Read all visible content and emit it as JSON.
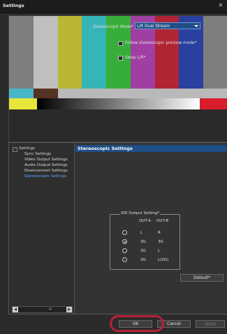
{
  "window": {
    "title": "Settings",
    "close_glyph": "✕"
  },
  "colors": {
    "bars_top": [
      "#7e7e7e",
      "#bfbfbf",
      "#b9b634",
      "#35b5b5",
      "#38ae3a",
      "#a13ea3",
      "#b12434",
      "#2940a0",
      "#7e7e7e"
    ],
    "bars_mid": [
      "#46b6c8",
      "#563222",
      "#b9b9b9",
      "#b9b9b9",
      "#b9b9b9",
      "#b9b9b9",
      "#b9b9b9",
      "#b9b9b9",
      "#b9b9b9"
    ],
    "bars_low_left": "#e6e63a",
    "bars_low_right": "#d81e2a",
    "bars_bottom": [
      "#2a2a2a",
      "#0a0a0a",
      "#f2f2f2",
      "#f2f2f2",
      "#0a0a0a",
      "#151515",
      "#222222",
      "#2a2a2a",
      "#2a2a2a"
    ],
    "accent": "#1f4f86"
  },
  "tree": {
    "root": "Settings",
    "toggle": "-",
    "items": [
      "Sync Settings",
      "Video Output Settings",
      "Audio Output Settings",
      "Downconvert Settings",
      "Stereoscopic Settings"
    ],
    "selected_index": 4,
    "scroll_left": "◀",
    "scroll_right": "▶",
    "scroll_thumb": "III"
  },
  "stereo": {
    "header": "Stereoscopic Settings",
    "mode_label": "Stereoscopic Mode*",
    "mode_value": "L/R Dual Stream",
    "follow_label": "Follow stereoscopic preview mode*",
    "swap_label": "Swap L/R*"
  },
  "sdi": {
    "title": "SDI Output Setting*",
    "col_a": "OUT-A",
    "col_b": "OUT-B",
    "rows": [
      {
        "a": "L",
        "b": "R"
      },
      {
        "a": "3G",
        "b": "3G"
      },
      {
        "a": "3G",
        "b": "L"
      },
      {
        "a": "3G",
        "b": "L(SD)"
      }
    ],
    "selected_row": 1
  },
  "buttons": {
    "default": "Default*",
    "ok": "OK",
    "cancel": "Cancel",
    "apply": "Apply"
  }
}
